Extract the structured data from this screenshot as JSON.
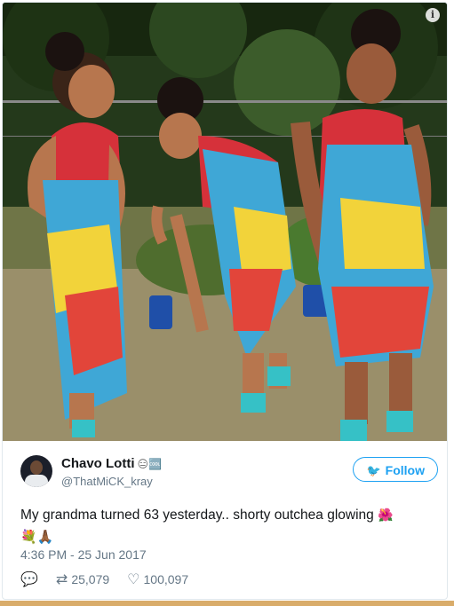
{
  "photo": {
    "alt_icon": "i"
  },
  "user": {
    "display_name": "Chavo Lotti",
    "name_emojis": "😑🆒",
    "handle": "@ThatMiCK_kray"
  },
  "follow_label": "Follow",
  "tweet": {
    "text": "My grandma turned 63 yesterday.. shorty outchea glowing",
    "flower_emoji": "🌺",
    "emoji_line": [
      "💐",
      "🙏🏾"
    ],
    "timestamp": "4:36 PM - 25 Jun 2017"
  },
  "actions": {
    "retweets": "25,079",
    "likes": "100,097"
  },
  "colors": {
    "accent": "#1da1f2",
    "muted": "#657786"
  }
}
